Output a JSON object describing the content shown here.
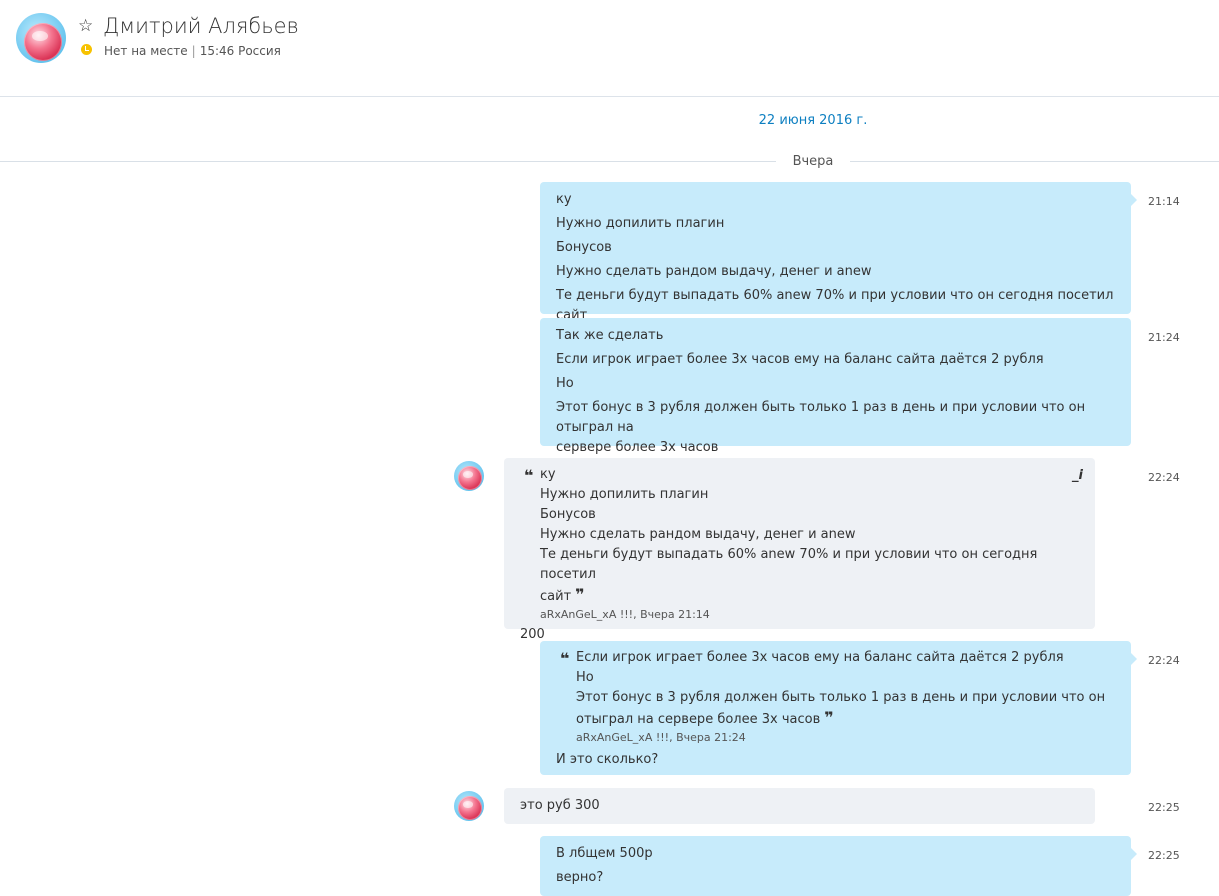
{
  "header": {
    "name": "Дмитрий Алябьев",
    "status": "Нет на месте",
    "separator": "|",
    "local_time": "15:46 Россия"
  },
  "conversation": {
    "date_header": "22 июня 2016 г.",
    "day_divider": "Вчера"
  },
  "messages": {
    "m1": {
      "time": "21:14",
      "lines": [
        "ку",
        "Нужно допилить плагин",
        "Бонусов",
        "Нужно сделать рандом выдачу, денег и anew",
        "Те деньги будут выпадать 60% anew 70% и при условии что он сегодня посетил сайт"
      ]
    },
    "m2": {
      "time": "21:24",
      "lines": [
        "Так же сделать",
        "Если игрок играет более 3х часов ему на баланс сайта даётся 2 рубля",
        "Но",
        "Этот бонус в 3 рубля должен быть только 1 раз в день и при условии что он отыграл на",
        "сервере более 3х часов"
      ]
    },
    "m3": {
      "time": "22:24",
      "quote_lines": [
        "ку",
        "Нужно допилить плагин",
        "Бонусов",
        "Нужно сделать рандом выдачу, денег и anew",
        "Те деньги будут выпадать 60% anew 70% и при условии что он сегодня посетил",
        "сайт"
      ],
      "quote_meta": "aRxAnGeL_xA !!!, Вчера 21:14",
      "text": "200",
      "edit_icon": "_i"
    },
    "m4": {
      "time": "22:24",
      "quote_lines": [
        "Если игрок играет более 3х часов ему на баланс сайта даётся 2 рубля",
        "Но",
        "Этот бонус в 3 рубля должен быть только 1 раз в день и при условии что он",
        "отыграл на сервере более 3х часов"
      ],
      "quote_meta": "aRxAnGeL_xA !!!, Вчера 21:24",
      "text": "И это сколько?"
    },
    "m5": {
      "time": "22:25",
      "text": "это руб 300"
    },
    "m6": {
      "time": "22:25",
      "lines": [
        "В лбщем 500р",
        "верно?"
      ]
    }
  },
  "quote_marks": {
    "open": "❝",
    "close": "❞"
  },
  "icons": {
    "star": "star-icon",
    "status": "clock-icon",
    "avatar": "skype-avatar"
  },
  "colors": {
    "outgoing_bubble": "#c7ebfb",
    "incoming_bubble": "#eef1f5",
    "accent": "#0d7fc1",
    "away_status": "#f7c200"
  }
}
